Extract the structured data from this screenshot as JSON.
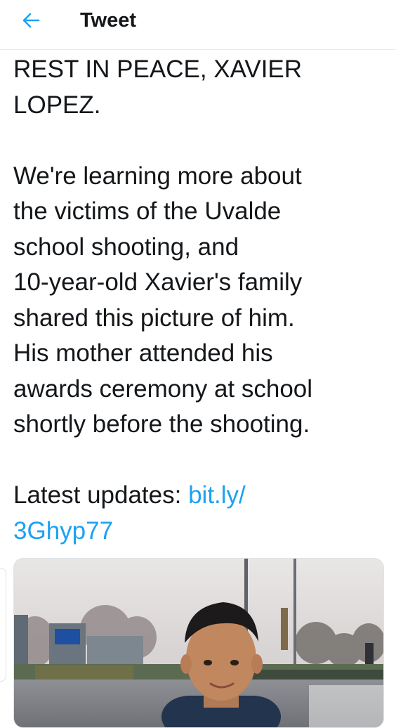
{
  "header": {
    "back_icon": "arrow-left-icon",
    "title": "Tweet",
    "accent_color": "#1da1f2"
  },
  "tweet": {
    "title_text": "REST IN PEACE, XAVIER\nLOPEZ.",
    "body_text": "We're learning more about\nthe victims of the Uvalde\nschool shooting, and\n10-year-old Xavier's family\nshared this picture of him.\nHis mother attended his\nawards ceremony at school\nshortly before the shooting.",
    "updates_label": "Latest updates: ",
    "updates_link_part1": "bit.ly/",
    "updates_link_part2": "3Ghyp77"
  },
  "media": {
    "kind": "photo"
  }
}
